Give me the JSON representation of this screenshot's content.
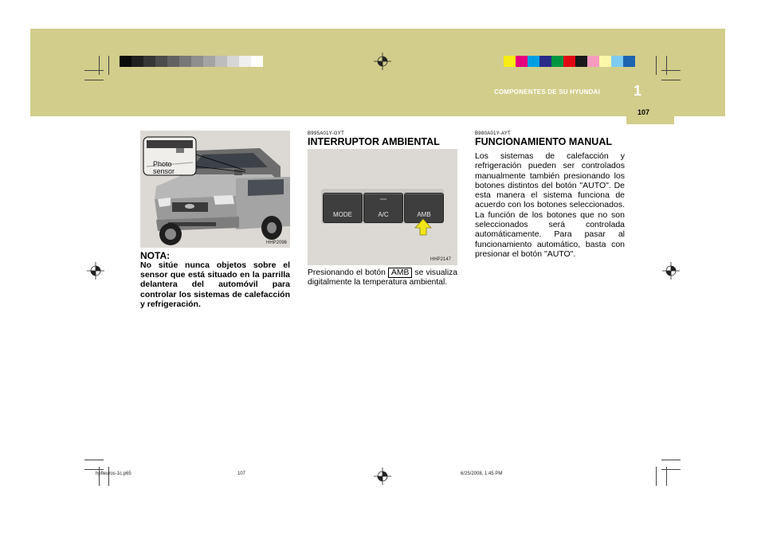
{
  "header": {
    "section_title": "COMPONENTES DE SU HYUNDAI",
    "chapter_number": "1",
    "page_number": "107"
  },
  "colors": {
    "band": "#d2cd8a",
    "grayscale_swatches": [
      "#0a0a0a",
      "#202020",
      "#363636",
      "#4c4c4c",
      "#626262",
      "#787878",
      "#8e8e8e",
      "#a4a4a4",
      "#bdbdbd",
      "#d6d6d6",
      "#efefef",
      "#ffffff"
    ],
    "color_swatches": [
      "#f7ec13",
      "#e6007e",
      "#009fe3",
      "#2a2a8a",
      "#009640",
      "#e30613",
      "#1a1a1a",
      "#f59bbf",
      "#fbf7a8",
      "#7fcbf0",
      "#1d64b0"
    ]
  },
  "left_column": {
    "figure_code": "HHP2096",
    "callout_label": "Photo sensor",
    "nota_title": "NOTA:",
    "nota_text": "No sitúe nunca objetos sobre el sensor que está situado en la parrilla delantera del automóvil para controlar los sistemas de calefacción y refrigeración."
  },
  "middle_column": {
    "code": "B995A01Y-GYT",
    "heading": "INTERRUPTOR AMBIENTAL",
    "figure_code": "HHP2147",
    "buttons": [
      "MODE",
      "A/C",
      "AMB"
    ],
    "text_before": "Presionando el botón",
    "amb_label": "AMB",
    "text_after": "se visualiza digitalmente la temperatura ambiental."
  },
  "right_column": {
    "code": "B980A01Y-AYT",
    "heading": "FUNCIONAMIENTO MANUAL",
    "text": "Los sistemas de calefacción y refrigeración pueden ser controlados manualmente también presionando los botones distintos del botón \"AUTO\". De esta manera el sistema funciona de acuerdo con los botones seleccionados. La función de los botones que no son seleccionados será controlada automáticamente. Para pasar al funcionamiento automático, basta con presionar el botón \"AUTO\"."
  },
  "footer": {
    "filename": "hpfleuros-1c.p65",
    "page": "107",
    "timestamp": "6/25/2008, 1:45 PM"
  }
}
